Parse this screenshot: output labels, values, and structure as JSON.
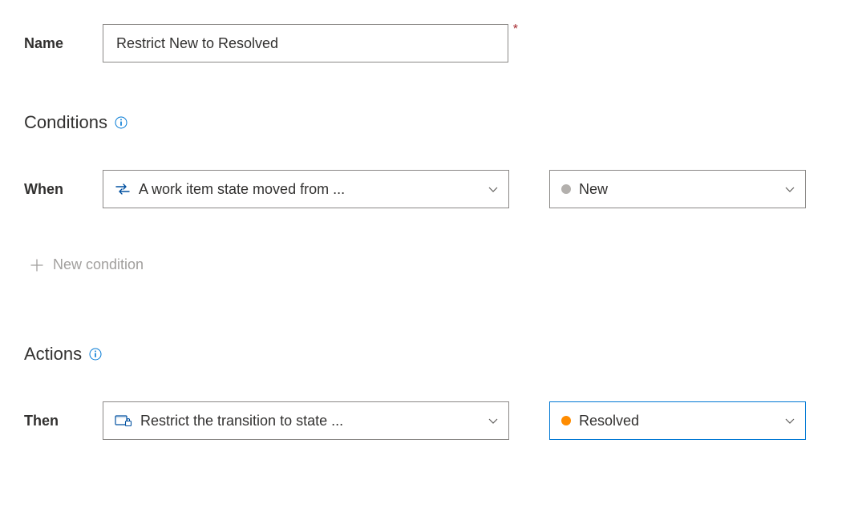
{
  "labels": {
    "name": "Name",
    "when": "When",
    "then": "Then"
  },
  "name_value": "Restrict New to Resolved",
  "sections": {
    "conditions": "Conditions",
    "actions": "Actions"
  },
  "condition": {
    "type_text": "A work item state moved from ...",
    "state_label": "New",
    "state_color": "#b3b0ad"
  },
  "new_condition_label": "New condition",
  "action": {
    "type_text": "Restrict the transition to state ...",
    "state_label": "Resolved",
    "state_color": "#ff8c00"
  }
}
